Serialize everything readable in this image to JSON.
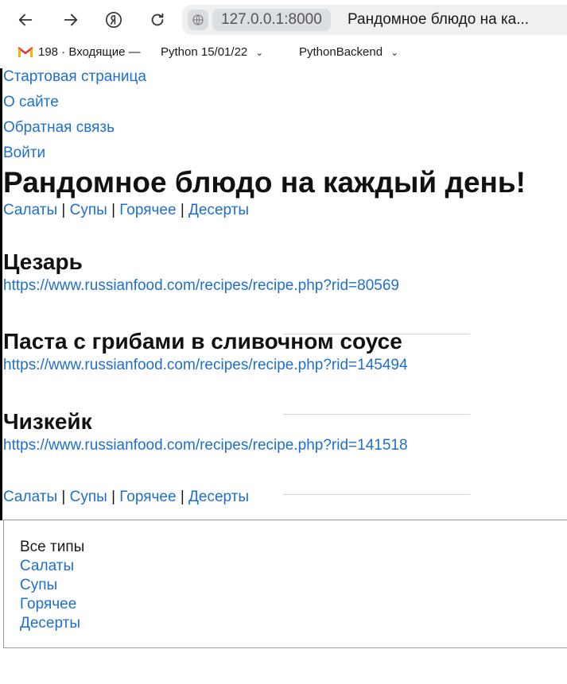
{
  "browser": {
    "url": "127.0.0.1:8000",
    "tab_title": "Рандомное блюдо на ка..."
  },
  "bookmarks": {
    "mail_label": "198 · Входящие —",
    "folder1": "Python 15/01/22",
    "folder2": "PythonBackend"
  },
  "nav": {
    "home": "Стартовая страница",
    "about": "О сайте",
    "feedback": "Обратная связь",
    "login": "Войти"
  },
  "page": {
    "title": "Рандомное блюдо на каждый день!"
  },
  "categories": [
    "Салаты",
    "Супы",
    "Горячее",
    "Десерты"
  ],
  "separator": "|",
  "recipes": [
    {
      "name": "Цезарь",
      "url": "https://www.russianfood.com/recipes/recipe.php?rid=80569"
    },
    {
      "name": "Паста с грибами в сливочном соусе",
      "url": "https://www.russianfood.com/recipes/recipe.php?rid=145494"
    },
    {
      "name": "Чизкейк",
      "url": "https://www.russianfood.com/recipes/recipe.php?rid=141518"
    }
  ],
  "footer": {
    "heading": "Все типы",
    "items": [
      "Салаты",
      "Супы",
      "Горячее",
      "Десерты"
    ]
  }
}
